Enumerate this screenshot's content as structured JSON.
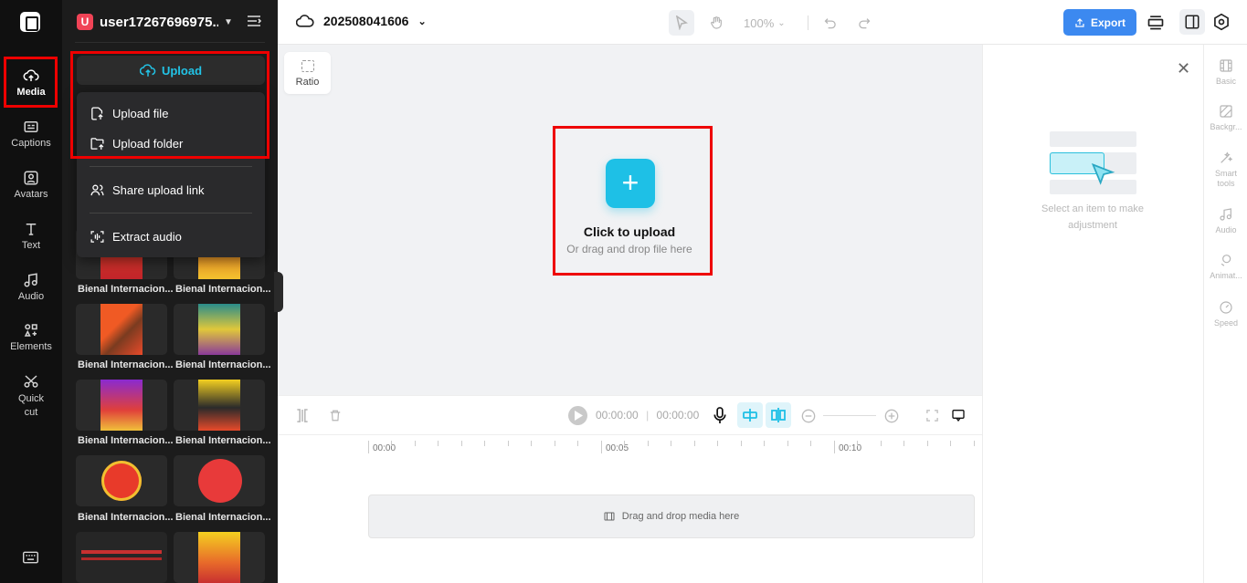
{
  "rail": {
    "items": [
      {
        "label": "Media"
      },
      {
        "label": "Captions"
      },
      {
        "label": "Avatars"
      },
      {
        "label": "Text"
      },
      {
        "label": "Audio"
      },
      {
        "label": "Elements"
      },
      {
        "label": "Quick cut"
      }
    ]
  },
  "panel": {
    "user_initial": "U",
    "username": "user17267696975...",
    "upload_label": "Upload",
    "dropdown": {
      "upload_file": "Upload file",
      "upload_folder": "Upload folder",
      "share_link": "Share upload link",
      "extract_audio": "Extract audio"
    },
    "thumb_label": "Bienal Internacion..."
  },
  "topbar": {
    "project_name": "202508041606",
    "zoom": "100%",
    "export_label": "Export"
  },
  "canvas": {
    "ratio_label": "Ratio",
    "click_to_upload": "Click to upload",
    "drag_hint": "Or drag and drop file here"
  },
  "right_panel": {
    "hint": "Select an item to make adjustment",
    "tabs": [
      "Basic",
      "Backgr...",
      "Smart tools",
      "Audio",
      "Animat...",
      "Speed"
    ]
  },
  "timeline": {
    "current_time": "00:00:00",
    "total_time": "00:00:00",
    "ticks": [
      "00:00",
      "00:05",
      "00:10"
    ],
    "drop_label": "Drag and drop media here"
  },
  "colors": {
    "accent": "#1ec0e6",
    "export": "#3c89f0",
    "annotation": "#e00000"
  }
}
